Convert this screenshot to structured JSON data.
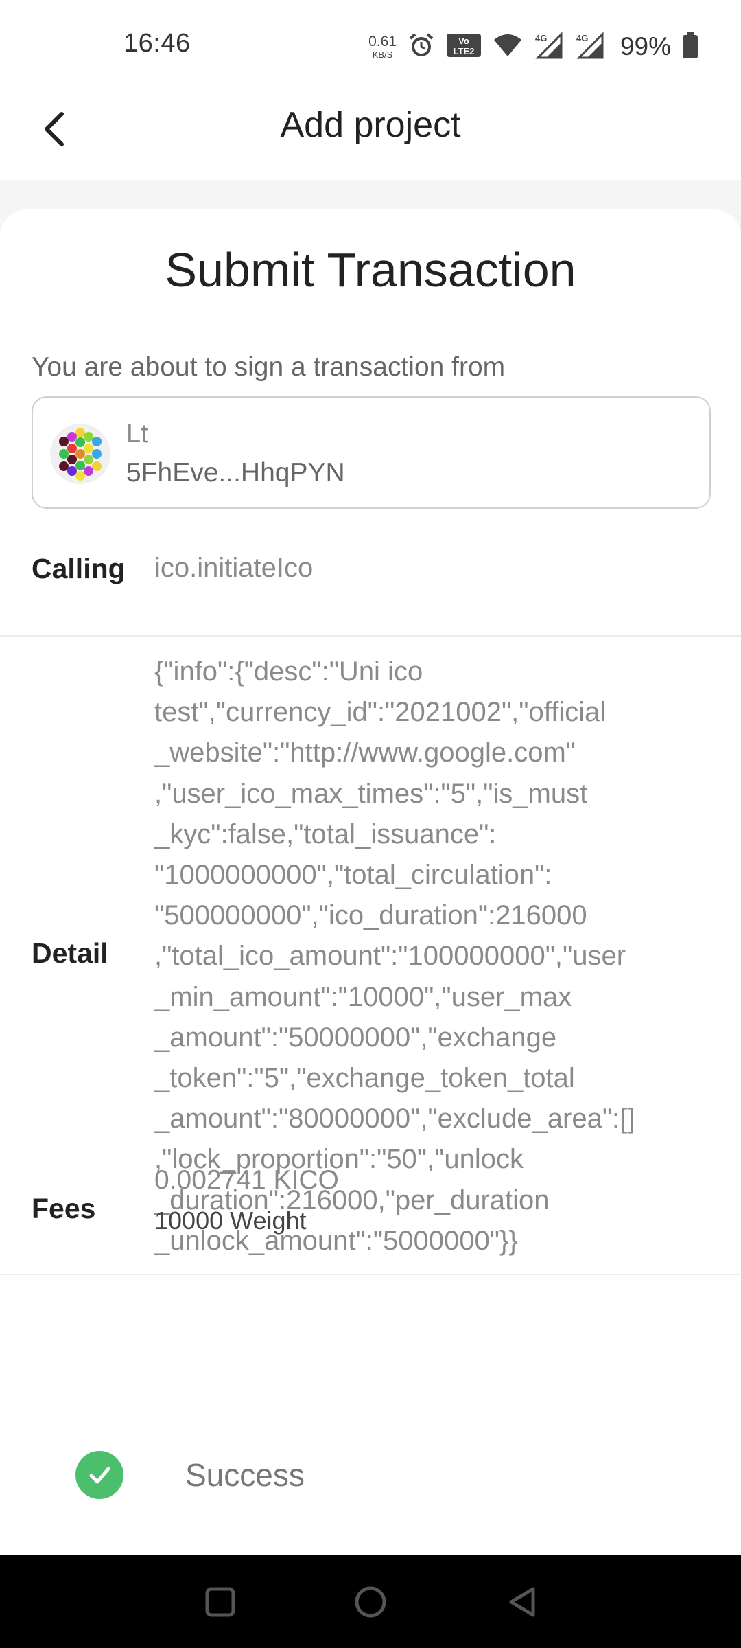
{
  "status_bar": {
    "time": "16:46",
    "net_speed_value": "0.61",
    "net_speed_unit": "KB/S",
    "volte_label": "VoLTE 2",
    "network_1": "4G",
    "network_2": "4G",
    "battery": "99%",
    "icons": [
      "alarm-icon",
      "volte-icon",
      "wifi-icon",
      "signal-icon",
      "signal-icon",
      "battery-icon"
    ]
  },
  "header": {
    "title": "Add project",
    "back_icon": "chevron-left-icon"
  },
  "transaction": {
    "title": "Submit Transaction",
    "sign_from_label": "You are about to sign a transaction from",
    "account": {
      "name": "Lt",
      "address": "5FhEve...HhqPYN"
    },
    "calling": {
      "label": "Calling",
      "value": "ico.initiateIco"
    },
    "detail": {
      "label": "Detail",
      "value": "{\"info\":{\"desc\":\"Uni ico\ntest\",\"currency_id\":\"2021002\",\"official\n_website\":\"http://www.google.com\"\n,\"user_ico_max_times\":\"5\",\"is_must\n_kyc\":false,\"total_issuance\":\n\"1000000000\",\"total_circulation\":\n\"500000000\",\"ico_duration\":216000\n,\"total_ico_amount\":\"100000000\",\"user\n_min_amount\":\"10000\",\"user_max\n_amount\":\"50000000\",\"exchange\n_token\":\"5\",\"exchange_token_total\n_amount\":\"80000000\",\"exclude_area\":[]\n,\"lock_proportion\":\"50\",\"unlock\n_duration\":216000,\"per_duration\n_unlock_amount\":\"5000000\"}}"
    },
    "fees": {
      "label": "Fees",
      "amount": "0.002741 KICO",
      "weight": "10000 Weight"
    },
    "status": {
      "text": "Success",
      "icon": "check-circle-icon",
      "color": "#4bbf6b"
    }
  },
  "nav_bar": {
    "buttons": [
      "recents-icon",
      "home-icon",
      "back-icon"
    ]
  }
}
